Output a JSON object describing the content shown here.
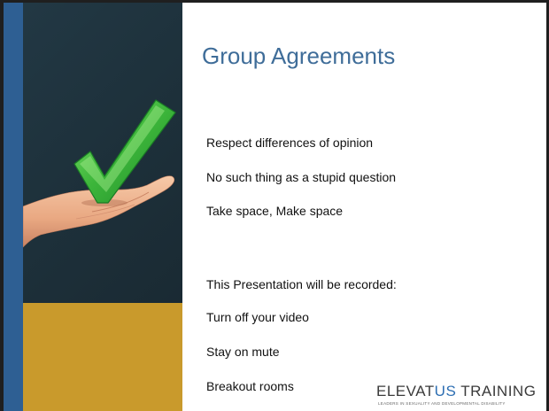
{
  "slide": {
    "title": "Group Agreements",
    "agreements": [
      "Respect differences of opinion",
      "No such thing as a stupid question",
      "Take space, Make space"
    ],
    "recording_notice": "This Presentation will be recorded:",
    "recording_items": [
      "Turn off your video",
      "Stay on mute",
      "Breakout rooms"
    ]
  },
  "logo": {
    "name_part1": "ELEVAT",
    "name_part2": "US",
    "name_part3": " TRAINING",
    "tagline": "LEADERS IN SEXUALITY AND DEVELOPMENTAL DISABILITY"
  },
  "colors": {
    "accent_blue": "#2e5f93",
    "title_blue": "#3f6d99",
    "dark_panel": "#1d303a",
    "gold_panel": "#c99a2c",
    "checkmark_green": "#3cb53a"
  },
  "icons": {
    "illustration": "hand-holding-checkmark-icon"
  }
}
